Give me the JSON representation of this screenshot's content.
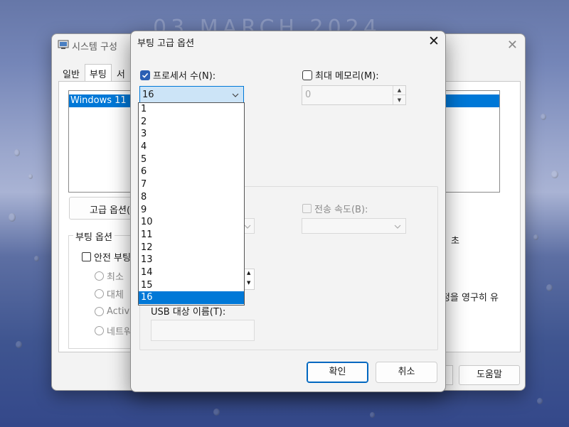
{
  "background": {
    "date_text": "03 MARCH 2024"
  },
  "back_window": {
    "title": "시스템 구성",
    "tabs": [
      {
        "label": "일반"
      },
      {
        "label": "부팅"
      },
      {
        "label": "서"
      }
    ],
    "os_entry": "Windows 11 (C",
    "advanced_button": "고급 옵션(",
    "boot_options_label": "부팅 옵션",
    "safe_boot_label": "안전 부팅",
    "radio_minimal": "최소 ",
    "radio_alternate": "대체 ",
    "radio_active": "Active",
    "radio_network": "네트워",
    "right_text_seconds": "초",
    "right_text_permanent": "설정을 영구히 유",
    "help_button": "도움말"
  },
  "dialog": {
    "title": "부팅 고급 옵션",
    "processor_count_label": "프로세서 수(N):",
    "processor_count_checked": true,
    "processor_value": "16",
    "max_memory_label": "최대 메모리(M):",
    "max_memory_checked": false,
    "max_memory_value": "0",
    "baud_rate_label": "전송 속도(B):",
    "usb_target_label": "USB 대상 이름(T):",
    "ok_button": "확인",
    "cancel_button": "취소"
  },
  "dropdown": {
    "options": [
      "1",
      "2",
      "3",
      "4",
      "5",
      "6",
      "7",
      "8",
      "9",
      "10",
      "11",
      "12",
      "13",
      "14",
      "15",
      "16"
    ],
    "selected": "16"
  },
  "colors": {
    "accent": "#0078d7",
    "checkbox_checked": "#2b5fb4"
  }
}
